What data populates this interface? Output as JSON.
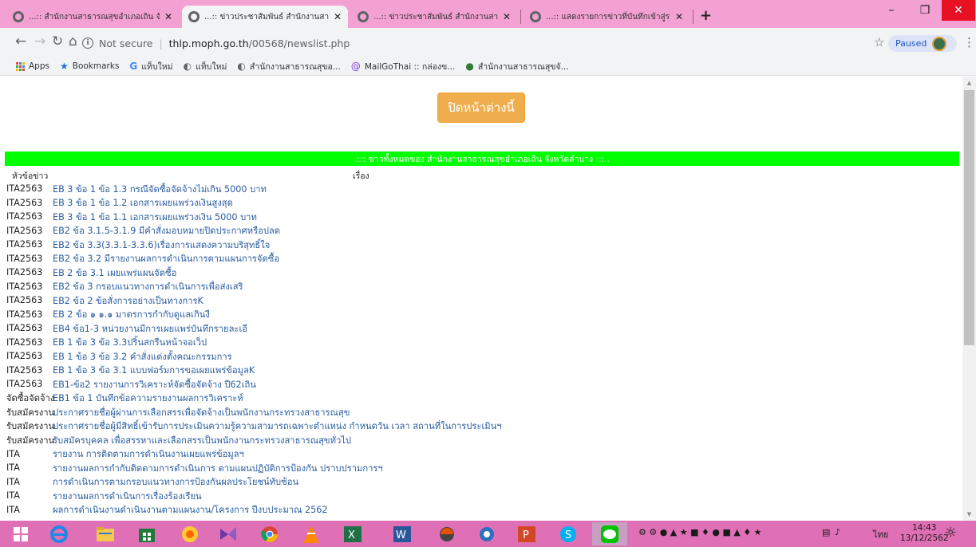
{
  "browser": {
    "tabs": [
      {
        "label": "...:: สำนักงานสาธารณสุขอำเภอเถิน จั",
        "active": false
      },
      {
        "label": "...:: ข่าวประชาสัมพันธ์ สำนักงานสาธา",
        "active": true
      },
      {
        "label": "...:: ข่าวประชาสัมพันธ์ สำนักงานสาธา",
        "active": false
      },
      {
        "label": "...:: แสดงรายการข่าวที่บันทึกเข้าสู่ระบ",
        "active": false
      }
    ],
    "new_tab_symbol": "+",
    "address": {
      "security_label": "Not secure",
      "host": "thlp.moph.go.th",
      "path": "/00568/newslist.php"
    },
    "profile_label": "Paused",
    "bookmarks": [
      {
        "label": "Apps",
        "icon": "apps-icon"
      },
      {
        "label": "Bookmarks",
        "icon": "star-icon"
      },
      {
        "label": "แท็บใหม่",
        "icon": "google-icon"
      },
      {
        "label": "แท็บใหม่",
        "icon": "globe-icon"
      },
      {
        "label": "สำนักงานสาธารณสุขอ...",
        "icon": "globe-icon"
      },
      {
        "label": "MailGoThai :: กล่องข...",
        "icon": "mail-icon"
      },
      {
        "label": "สำนักงานสาธารณสุขจั...",
        "icon": "site-icon"
      }
    ]
  },
  "page": {
    "close_button": "ปิดหน้าต่างนี้",
    "header": ".::: ข่าวทั้งหมดของ สำนักงานสาธารณสุขอำเภอเถิน จังหวัดลำปาง :::..",
    "col_category": "หัวข้อข่าว",
    "col_title": "เรื่อง",
    "rows": [
      {
        "cat": "ITA2563",
        "title": "EB 3 ข้อ 1 ข้อ 1.3 กรณีจัดซื้อจัดจ้างไม่เกิน 5000 บาท"
      },
      {
        "cat": "ITA2563",
        "title": "EB 3 ข้อ 1 ข้อ 1.2 เอกสารเผยแพร่วงเงินสูงสุด"
      },
      {
        "cat": "ITA2563",
        "title": "EB 3 ข้อ 1 ข้อ 1.1 เอกสารเผยแพร่วงเงิน 5000 บาท"
      },
      {
        "cat": "ITA2563",
        "title": "EB2 ข้อ 3.1.5-3.1.9 มีคำสั่งมอบหมายปิดประกาศหรือปลด"
      },
      {
        "cat": "ITA2563",
        "title": "EB2 ข้อ 3.3(3.3.1-3.3.6)เรื่องการแสดงความบริสุทธิ์ใจ"
      },
      {
        "cat": "ITA2563",
        "title": "EB2 ข้อ 3.2 มีรายงานผลการดำเนินการตามแผนการจัดซื้อ"
      },
      {
        "cat": "ITA2563",
        "title": "EB 2 ข้อ 3.1 เผยแพร่แผนจัดซื้อ"
      },
      {
        "cat": "ITA2563",
        "title": "EB2 ข้อ 3 กรอบแนวทางการดำเนินการเพื่อส่งเสริ"
      },
      {
        "cat": "ITA2563",
        "title": "EB2 ข้อ 2 ข้อสั่งการอย่างเป็นทางการK"
      },
      {
        "cat": "ITA2563",
        "title": "EB 2 ข้อ ๑ ๑.๑ มาตรการกำกับดูแลเกินงี"
      },
      {
        "cat": "ITA2563",
        "title": "EB4 ข้อ1-3 หน่วยงานมีการเผยแพร่บันทึกรายละเอี"
      },
      {
        "cat": "ITA2563",
        "title": "EB 1 ข้อ 3 ข้อ 3.3ปริ้นสกรีนหน้าจอเว็ป"
      },
      {
        "cat": "ITA2563",
        "title": "EB 1 ข้อ 3 ข้อ 3.2 คำสั่งแต่งตั้งคณะกรรมการ"
      },
      {
        "cat": "ITA2563",
        "title": "EB 1 ข้อ 3 ข้อ 3.1 แบบฟอร์มการขอเผยแพร่ข้อมูลK"
      },
      {
        "cat": "ITA2563",
        "title": "EB1-ข้อ2 รายงานการวิเคราะห์จัดซื้อจัดจ้าง ปี62เถิน"
      },
      {
        "cat": "จัดซื้อจัดจ้าง",
        "title": "EB1 ข้อ 1 บันทึกข้อความรายงานผลการวิเคราะห์"
      },
      {
        "cat": "รับสมัครงาน",
        "title": "ประกาศรายชื่อผู้ผ่านการเลือกสรรเพื่อจัดจ้างเป็นพนักงานกระทรวงสาธารณสุข"
      },
      {
        "cat": "รับสมัครงาน",
        "title": "ประกาศรายชื่อผู้มีสิทธิ์เข้ารับการประเมินความรู้ความสามารถเฉพาะตำแหน่ง กำหนดวัน เวลา สถานที่ในการประเมินฯ"
      },
      {
        "cat": "รับสมัครงาน",
        "title": "รับสมัครบุคคล เพื่อสรรหาและเลือกสรรเป็นพนักงานกระทรวงสาธารณสุขทั่วไป"
      },
      {
        "cat": "ITA",
        "title": "รายงาน การติดตามการดำเนินงานเผยแพร่ข้อมูลฯ"
      },
      {
        "cat": "ITA",
        "title": "รายงานผลการกำกับติดตามการดำเนินการ ตามแผนปฏิบัติการป้องกัน ปราบปรามการฯ"
      },
      {
        "cat": "ITA",
        "title": "การดำเนินการตามกรอบแนวทางการป้องกันผลประโยชน์ทับซ้อน"
      },
      {
        "cat": "ITA",
        "title": "รายงานผลการดำเนินการเรื่องร้องเรียน"
      },
      {
        "cat": "ITA",
        "title": "ผลการดำเนินงานดำเนินงานตามแผนงาน/โครงการ ปีงบประมาณ 2562"
      }
    ]
  },
  "taskbar": {
    "language": "ไทย",
    "time": "14:43",
    "date": "13/12/2562"
  },
  "colors": {
    "tab_bar": "#f3a0d3",
    "taskbar": "#e070b5",
    "header_green": "#00ff00",
    "button_orange": "#f0ad4e",
    "link_blue": "#2a5d9f"
  }
}
